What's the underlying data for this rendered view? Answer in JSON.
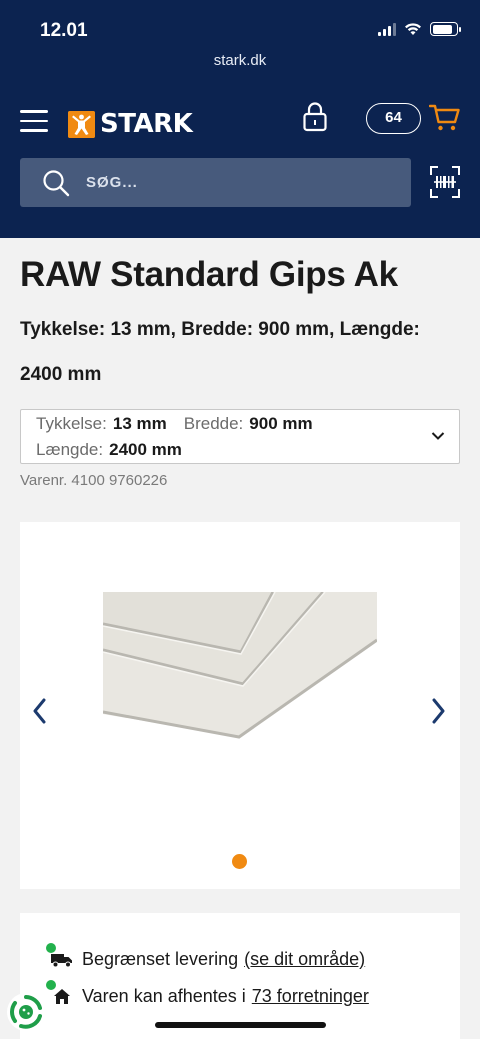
{
  "status_bar": {
    "time": "12.01",
    "battery_level": 0.85
  },
  "browser": {
    "url": "stark.dk"
  },
  "header": {
    "logo_text": "STARK",
    "cart_count": "64",
    "search_placeholder": "SØG...",
    "icons": [
      "menu-icon",
      "lock-icon",
      "cart-icon",
      "search-icon",
      "barcode-scan-icon"
    ]
  },
  "product": {
    "title": "RAW Standard Gips Ak",
    "subtitle": "Tykkelse: 13 mm, Bredde: 900 mm, Længde: 2400 mm",
    "variant": {
      "thickness_label": "Tykkelse:",
      "thickness_value": "13 mm",
      "width_label": "Bredde:",
      "width_value": "900 mm",
      "length_label": "Længde:",
      "length_value": "2400 mm"
    },
    "sku": "Varenr. 4100 9760226"
  },
  "gallery": {
    "image_count": 1,
    "active_index": 0,
    "image_subject": "gypsum-boards"
  },
  "availability": {
    "delivery_text": "Begrænset levering",
    "delivery_link": "(se dit område)",
    "pickup_text": "Varen kan afhentes i",
    "pickup_link": "73 forretninger"
  },
  "colors": {
    "header_bg": "#0c2350",
    "search_bg": "#475a7c",
    "brand_orange": "#f08a12",
    "accent_blue": "#1c3a6e",
    "status_green": "#22b14c",
    "dot_active": "#f08a12"
  }
}
